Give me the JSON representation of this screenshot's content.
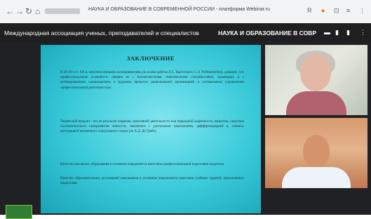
{
  "browser": {
    "icons": {
      "back": "←",
      "forward": "→",
      "reload": "↻",
      "home": "⌂"
    },
    "tab_title": "НАУКА И ОБРАЗОВАНИЕ В СОВРЕМЕННОЙ РОССИИ - платформа Webinar.ru",
    "extension_icons": [
      "R",
      "●",
      "⊡",
      "≡",
      "⋮"
    ]
  },
  "meeting": {
    "organization": "Международная ассоциация ученых, преподавателей и специалистов",
    "conference_title": "НАУКА И ОБРАЗОВАНИЕ В СОВР",
    "header_icons": [
      "▬",
      "▮",
      "▮",
      "⋮"
    ]
  },
  "slide": {
    "heading": "ЗАКЛЮЧЕНИЕ",
    "paragraphs": [
      "В 20-30-х гг. XX в. многочисленными экспериментами, (в основе работы Л.С. Выготского, С.Л. Рубинштейна), доказано, что профессиональная успешность связана не с биологическими, генетическими способностями, заданными, а с мотивированным саморазвитием в трудовом процессе, рациональной организацией и оптимальным управлением профессиональной деятельностью.",
      "Творческий продукт - это не результат озарения, креативной деятельности или природной одаренности, напротив, следствие систематического саморазвития личности, связанного с длительным накоплением, дифференциацией и, главное, интеграцией жизненного и актуального опыта (по А.Д. Де Грейт).",
      "Качество школьного образования в основном определяется качеством профессиональной подготовки педагогов.",
      "Качество образовательных достижений школьников в основном определяется качеством учебных заданий, предлагаемых педагогами."
    ]
  },
  "participants": [
    {
      "id": "participant-1"
    },
    {
      "id": "participant-2"
    }
  ]
}
